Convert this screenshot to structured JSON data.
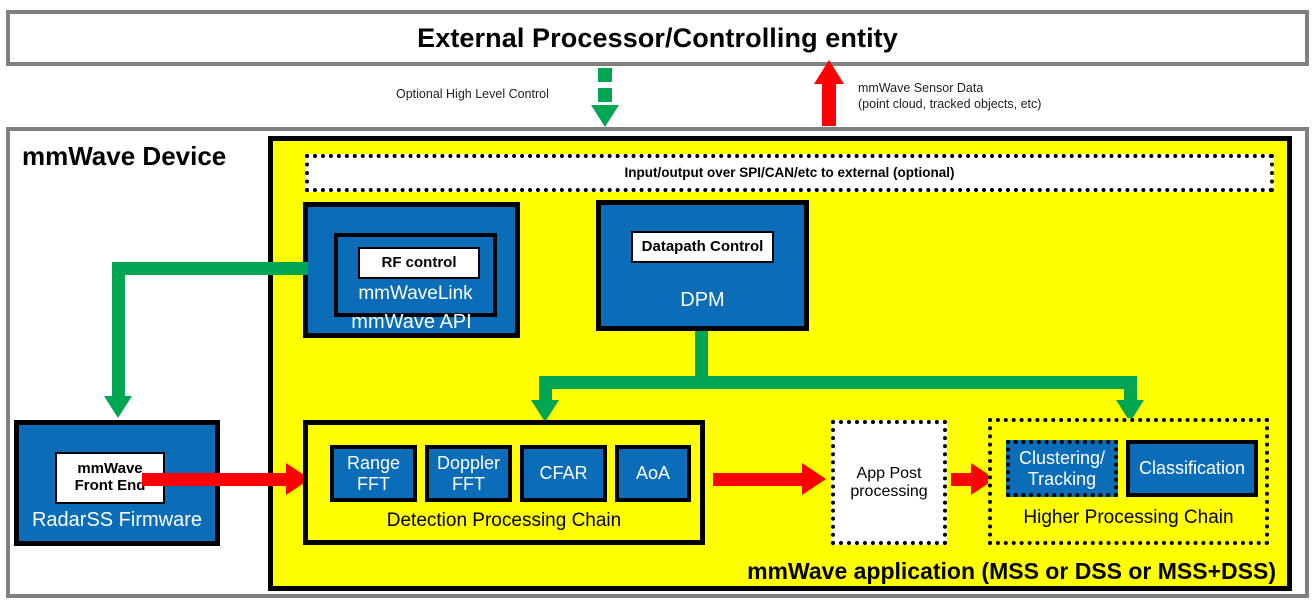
{
  "external_processor": {
    "title": "External Processor/Controlling entity"
  },
  "connectors": {
    "high_level_control_label": "Optional High Level Control",
    "sensor_data_label_line1": "mmWave Sensor Data",
    "sensor_data_label_line2": "(point cloud, tracked objects, etc)"
  },
  "device": {
    "title": "mmWave Device",
    "io_strip_label": "Input/output over SPI/CAN/etc to external (optional)",
    "app_footer_label": "mmWave application (MSS or DSS or MSS+DSS)"
  },
  "mmwave_api": {
    "caption": "mmWave API",
    "inner_caption": "mmWaveLink",
    "rf_control_label": "RF control"
  },
  "dpm": {
    "caption": "DPM",
    "datapath_control_label": "Datapath Control"
  },
  "radarss": {
    "caption": "RadarSS Firmware",
    "front_end_line1": "mmWave",
    "front_end_line2": "Front End"
  },
  "detection_chain": {
    "caption": "Detection Processing Chain",
    "blocks": [
      {
        "line1": "Range",
        "line2": "FFT"
      },
      {
        "line1": "Doppler",
        "line2": "FFT"
      },
      {
        "line1": "CFAR",
        "line2": ""
      },
      {
        "line1": "AoA",
        "line2": ""
      }
    ]
  },
  "app_post": {
    "line1": "App Post",
    "line2": "processing"
  },
  "higher_chain": {
    "caption": "Higher Processing Chain",
    "blocks": [
      {
        "line1": "Clustering/",
        "line2": "Tracking"
      },
      {
        "line1": "Classification",
        "line2": ""
      }
    ]
  },
  "colors": {
    "blue": "#0B6CB8",
    "yellow": "#FFFF00",
    "green": "#00A651",
    "red": "#FF0000",
    "frame_gray": "#808080",
    "black": "#000000",
    "white": "#FFFFFF"
  }
}
